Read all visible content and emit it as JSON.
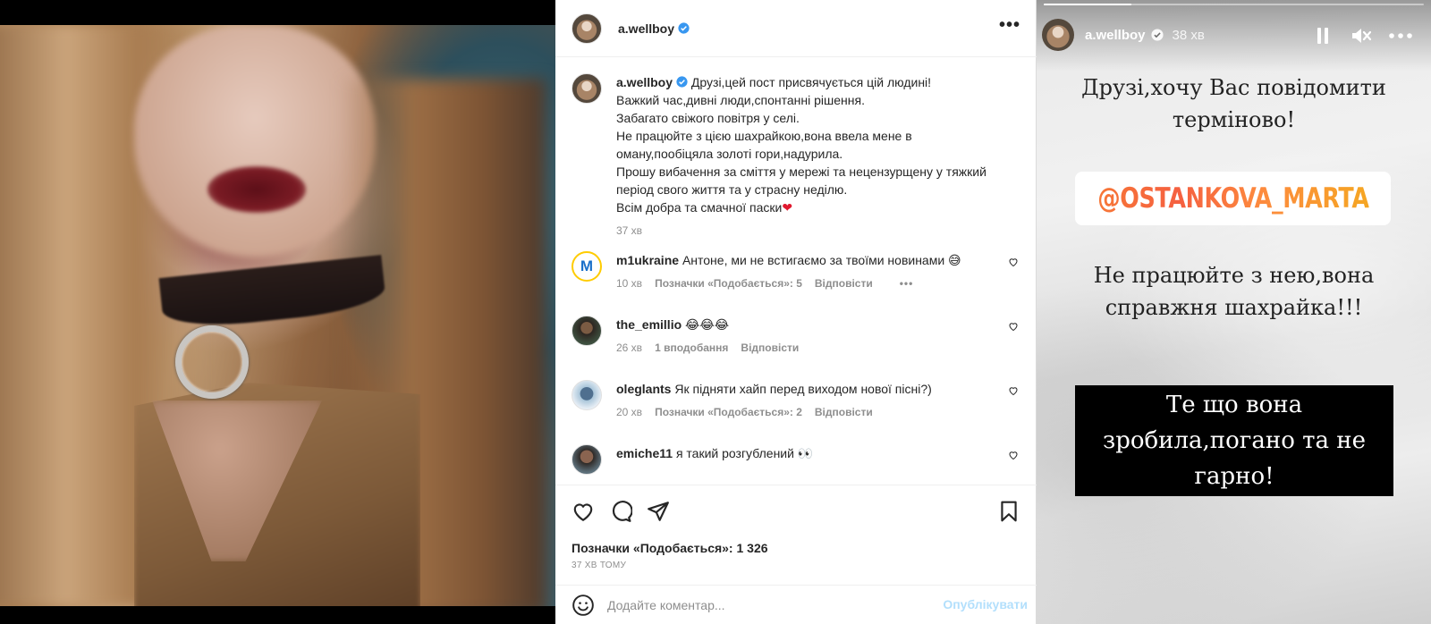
{
  "post": {
    "author": "a.wellboy",
    "caption": "Друзі,цей пост присвячується цій людині!\nВажкий час,дивні люди,спонтанні рішення.\nЗабагато свіжого повітря у селі.\nНе працюйте з цією шахрайкою,вона ввела мене в оману,пообіцяла золоті гори,надурила.\nПрошу вибачення за сміття у мережі та нецензурщену у тяжкий період свого життя та у страсну неділю.\nВсім добра та смачної паски",
    "caption_emoji": "❤",
    "caption_time": "37 хв",
    "comments": [
      {
        "user": "m1ukraine",
        "text": "Антоне, ми не встигаємо за твоїми новинами 😅",
        "time": "10 хв",
        "likes": "Позначки «Подобається»: 5",
        "reply": "Відповісти",
        "more": "•••"
      },
      {
        "user": "the_emillio",
        "text": "😂😂😂",
        "time": "26 хв",
        "likes": "1 вподобання",
        "reply": "Відповісти"
      },
      {
        "user": "oleglants",
        "text": "Як підняти хайп перед виходом нової пісні?)",
        "time": "20 хв",
        "likes": "Позначки «Подобається»: 2",
        "reply": "Відповісти"
      },
      {
        "user": "emiche11",
        "text": "я такий розгублений 👀"
      }
    ],
    "likes_label": "Позначки «Подобається»: 1 326",
    "time_ago": "37 хв тому",
    "comment_placeholder": "Додайте коментар...",
    "publish_label": "Опублікувати",
    "colors": {
      "verified": "#3897f0",
      "publish": "#b2dffc",
      "heart": "#e0192f"
    }
  },
  "story": {
    "author": "a.wellboy",
    "time": "38 хв",
    "progress": 0.23,
    "line1": "Друзі,хочу Вас повідомити",
    "line2": "терміново!",
    "mention": "@OSTANKOVA_MARTA",
    "line3": "Не працюйте з нею,вона",
    "line4": "справжня шахрайка!!!",
    "box_line1": "Те що вона",
    "box_line2": "зробила,погано та не",
    "box_line3": "гарно!"
  }
}
